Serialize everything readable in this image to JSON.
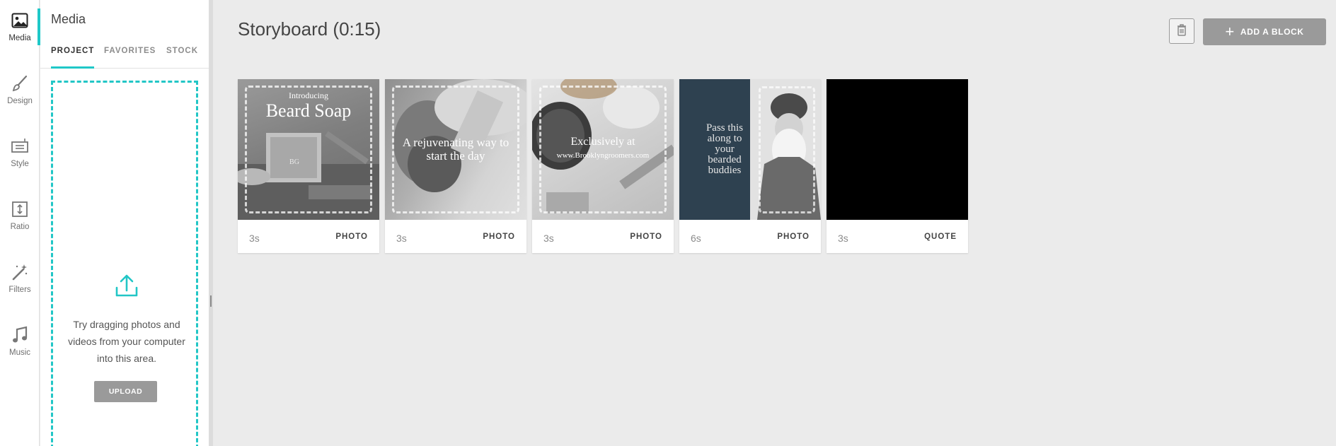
{
  "rail": {
    "items": [
      {
        "label": "Media",
        "icon": "image-icon"
      },
      {
        "label": "Design",
        "icon": "brush-icon"
      },
      {
        "label": "Style",
        "icon": "text-style-icon"
      },
      {
        "label": "Ratio",
        "icon": "aspect-ratio-icon"
      },
      {
        "label": "Filters",
        "icon": "magic-wand-icon"
      },
      {
        "label": "Music",
        "icon": "music-note-icon"
      }
    ]
  },
  "panel": {
    "title": "Media",
    "tabs": [
      "PROJECT",
      "FAVORITES",
      "STOCK"
    ],
    "active_tab": "PROJECT",
    "drop_text": "Try dragging photos and videos from your computer into this area.",
    "upload_label": "UPLOAD"
  },
  "main": {
    "title": "Storyboard (0:15)",
    "add_block_label": "ADD A BLOCK",
    "cards": [
      {
        "duration": "3s",
        "type": "PHOTO",
        "overlay_small": "Introducing",
        "overlay_large": "Beard Soap"
      },
      {
        "duration": "3s",
        "type": "PHOTO",
        "overlay": "A rejuvenating way to start the day"
      },
      {
        "duration": "3s",
        "type": "PHOTO",
        "overlay": "Exclusively at",
        "overlay_url": "www.Brooklyngroomers.com"
      },
      {
        "duration": "6s",
        "type": "PHOTO",
        "overlay": "Pass this along to your bearded buddies"
      },
      {
        "duration": "3s",
        "type": "QUOTE"
      }
    ]
  },
  "colors": {
    "accent": "#1fc8c8",
    "button_gray": "#9a9a9a",
    "background": "#ebebeb",
    "card4_panel": "#2e4150"
  }
}
